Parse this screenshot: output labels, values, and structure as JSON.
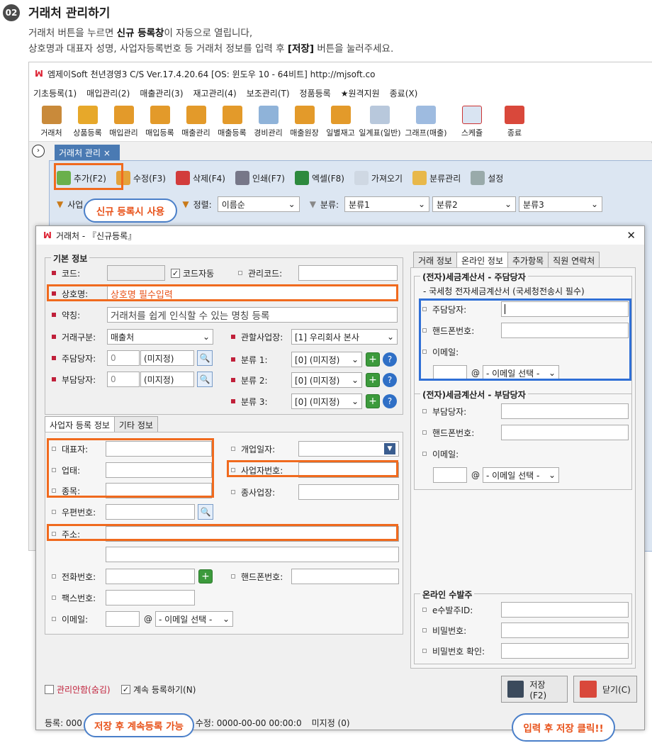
{
  "header": {
    "number": "02",
    "title": "거래처 관리하기",
    "desc1_a": "거래처 버튼을 누르면 ",
    "desc1_b": "신규 등록창",
    "desc1_c": "이 자동으로 열립니다,",
    "desc2_a": "상호명과 대표자 성명, 사업자등록번호 등 거래처 정보를 입력 후 ",
    "desc2_b": "[저장]",
    "desc2_c": " 버튼을 눌러주세요."
  },
  "app": {
    "title": "엠제이Soft 천년경영3 C/S   Ver.17.4.20.64   [OS: 윈도우 10 - 64비트]   http://mjsoft.co",
    "menu": [
      "기초등록(1)",
      "매입관리(2)",
      "매출관리(3)",
      "재고관리(4)",
      "보조관리(T)",
      "정품등록",
      "★원격지원",
      "종료(X)"
    ],
    "toolbar": [
      "거래처",
      "상품등록",
      "매입관리",
      "매입등록",
      "매출관리",
      "매출등록",
      "경비관리",
      "매출원장",
      "일별재고",
      "일계표(일반)",
      "그래프(매출)",
      "스케쥴",
      "종료"
    ],
    "doc_tab": "거래처 관리 ×",
    "subtoolbar": [
      "추가(F2)",
      "수정(F3)",
      "삭제(F4)",
      "인쇄(F7)",
      "엑셀(F8)",
      "가져오기",
      "분류관리",
      "설정"
    ],
    "filter": {
      "sort_label": "정렬:",
      "sort_value": "이름순",
      "cat_label": "분류:",
      "cat1": "분류1",
      "cat2": "분류2",
      "cat3": "분류3",
      "first_label": "사업"
    }
  },
  "dialog": {
    "title": "거래처 - 『신규등록』",
    "basic": {
      "legend": "기본 정보",
      "code": "코드:",
      "autocode": "코드자동",
      "mgmt_code": "관리코드:",
      "name": "상호명:",
      "name_hint": "상호명 필수입력",
      "alias": "약칭:",
      "alias_hint": "거래처를 쉽게 인식할 수 있는 명칭 등록",
      "type": "거래구분:",
      "type_value": "매출처",
      "branch": "관할사업장:",
      "branch_value": "[1] 우리회사 본사",
      "main_mgr": "주담당자:",
      "main_mgr_code": "0",
      "main_mgr_value": "(미지정)",
      "sub_mgr": "부담당자:",
      "sub_mgr_code": "0",
      "sub_mgr_value": "(미지정)",
      "c1": "분류 1:",
      "c2": "분류 2:",
      "c3": "분류 3:",
      "c_value": "[0] (미지정)"
    },
    "tabs_left": [
      "사업자 등록 정보",
      "기타 정보"
    ],
    "biz": {
      "ceo": "대표자:",
      "biztype": "업태:",
      "item": "종목:",
      "open_date": "개업일자:",
      "biz_no": "사업자번호:",
      "sub_site": "종사업장:",
      "zip": "우편번호:",
      "addr": "주소:",
      "phone": "전화번호:",
      "mobile": "핸드폰번호:",
      "fax": "팩스번호:",
      "email": "이메일:",
      "email_select": "- 이메일 선택 -"
    },
    "tabs_right": [
      "거래 정보",
      "온라인 정보",
      "추가항목",
      "직원 연락처"
    ],
    "tax_main": {
      "legend": "(전자)세금계산서 - 주담당자",
      "note": "- 국세청 전자세금계산서 (국세청전송시 필수)",
      "mgr": "주담당자:",
      "mobile": "핸드폰번호:",
      "email": "이메일:",
      "email_select": "- 이메일 선택 -"
    },
    "tax_sub": {
      "legend": "(전자)세금계산서 - 부담당자",
      "mgr": "부담당자:",
      "mobile": "핸드폰번호:",
      "email": "이메일:",
      "email_select": "- 이메일 선택 -"
    },
    "online": {
      "legend": "온라인 수발주",
      "id": "e수발주ID:",
      "pw": "비밀번호:",
      "pw2": "비밀번호 확인:"
    },
    "hide": "관리안함(숨김)",
    "continue": "계속 등록하기(N)",
    "save": "저장(F2)",
    "close": "닫기(C)",
    "status": {
      "reg": "등록: 000",
      "mod": "수정: 0000-00-00 00:00:0",
      "unassigned": "미지정 (0)"
    }
  },
  "callouts": {
    "new": "신규 등록시 사용",
    "continue": "저장 후 계속등록 가능",
    "save": "입력 후 저장 클릭!!"
  },
  "colors": {
    "accent_orange": "#f06a1e",
    "accent_blue": "#2f6fd6",
    "tab_blue": "#4a7ab3"
  }
}
